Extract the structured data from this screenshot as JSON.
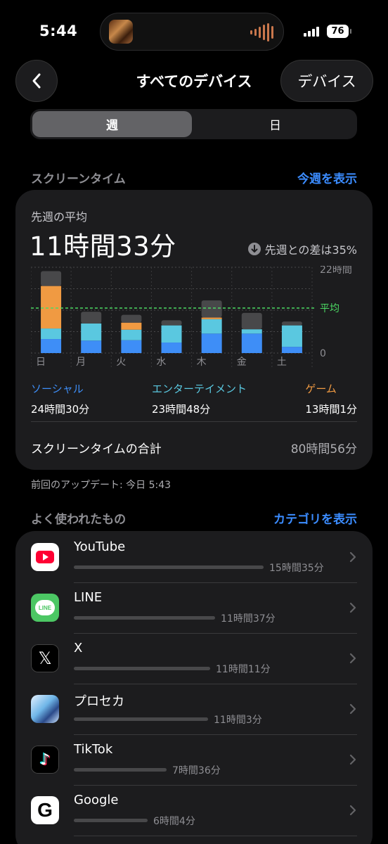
{
  "status": {
    "time": "5:44",
    "battery": "76"
  },
  "header": {
    "title": "すべてのデバイス",
    "devices_label": "デバイス"
  },
  "segment": {
    "week": "週",
    "day": "日"
  },
  "screen_time": {
    "section_label": "スクリーンタイム",
    "show_week_link": "今週を表示",
    "avg_label": "先週の平均",
    "avg_value": "11時間33分",
    "diff_text": "先週との差は35%",
    "legend": [
      {
        "name": "ソーシャル",
        "value": "24時間30分",
        "color": "#3e8ef7"
      },
      {
        "name": "エンターテイメント",
        "value": "23時間48分",
        "color": "#5ac8e0"
      },
      {
        "name": "ゲーム",
        "value": "13時間1分",
        "color": "#f09a42"
      }
    ],
    "total_label": "スクリーンタイムの合計",
    "total_value": "80時間56分",
    "updated": "前回のアップデート: 今日 5:43"
  },
  "chart_data": {
    "type": "bar",
    "stacked": true,
    "categories": [
      "日",
      "月",
      "火",
      "水",
      "木",
      "金",
      "土"
    ],
    "series": [
      {
        "name": "ソーシャル",
        "color": "#3e8ef7",
        "values": [
          3.6,
          3.2,
          3.3,
          2.7,
          5.0,
          5.0,
          1.6
        ]
      },
      {
        "name": "エンターテイメント",
        "color": "#5ac8e0",
        "values": [
          2.7,
          4.4,
          2.7,
          4.4,
          3.7,
          1.1,
          5.5
        ]
      },
      {
        "name": "ゲーム",
        "color": "#f09a42",
        "values": [
          10.9,
          0,
          1.8,
          0,
          0.4,
          0,
          0
        ]
      },
      {
        "name": "",
        "color": "#48484a",
        "values": [
          3.8,
          3.0,
          2.0,
          1.3,
          4.4,
          4.2,
          1.0
        ]
      }
    ],
    "ylim": [
      0,
      22
    ],
    "y_ticks": [
      "22時間",
      "0"
    ],
    "average": 11.55,
    "average_label": "平均",
    "average_color": "#4cd964"
  },
  "most_used": {
    "section_label": "よく使われたもの",
    "category_link": "カテゴリを表示",
    "apps": [
      {
        "name": "YouTube",
        "time": "15時間35分",
        "minutes": 935,
        "icon": "youtube-icon"
      },
      {
        "name": "LINE",
        "time": "11時間37分",
        "minutes": 697,
        "icon": "line-icon"
      },
      {
        "name": "X",
        "time": "11時間11分",
        "minutes": 671,
        "icon": "x-icon"
      },
      {
        "name": "プロセカ",
        "time": "11時間3分",
        "minutes": 663,
        "icon": "prosekai-icon"
      },
      {
        "name": "TikTok",
        "time": "7時間36分",
        "minutes": 456,
        "icon": "tiktok-icon"
      },
      {
        "name": "Google",
        "time": "6時間4分",
        "minutes": 364,
        "icon": "google-icon"
      }
    ]
  }
}
